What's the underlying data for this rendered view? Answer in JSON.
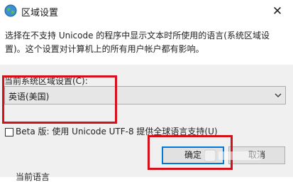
{
  "window": {
    "title": "区域设置",
    "icon": "globe-icon",
    "close_glyph": "✕"
  },
  "description": "选择在不支持 Unicode 的程序中显示文本时所使用的语言(系统区域设置)。这个设置对计算机上的所有用户帐户都有影响。",
  "locale": {
    "label": "当前系统区域设置(C):",
    "value": "英语(美国)",
    "dropdown_icon": "chevron-down-icon"
  },
  "beta_option": {
    "checked": false,
    "label": "Beta 版: 使用 Unicode UTF-8 提供全球语言支持(U)"
  },
  "buttons": {
    "ok": "确定",
    "cancel": "取消"
  },
  "bottom_cut_text": "当前语言",
  "annotation_color": "#d4101a",
  "accent_color": "#0078d7"
}
